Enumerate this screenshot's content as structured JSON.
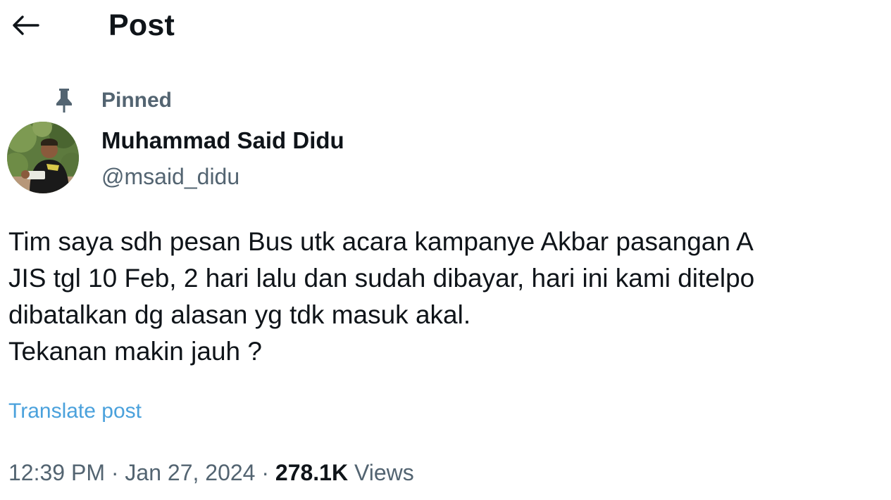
{
  "header": {
    "back_icon": "arrow-left-icon",
    "title": "Post"
  },
  "pinned": {
    "icon": "pin-icon",
    "label": "Pinned"
  },
  "author": {
    "name": "Muhammad Said Didu",
    "handle": "@msaid_didu"
  },
  "post": {
    "lines": [
      "Tim saya sdh pesan Bus utk acara kampanye Akbar pasangan A",
      "JIS tgl 10 Feb, 2 hari lalu dan sudah dibayar, hari ini kami ditelpo",
      "dibatalkan dg alasan yg tdk masuk akal.",
      "Tekanan makin jauh ?"
    ],
    "translate_label": "Translate post"
  },
  "meta": {
    "time": "12:39 PM",
    "sep1": " · ",
    "date": "Jan 27, 2024",
    "sep2": " · ",
    "views_count": "278.1K",
    "views_label": " Views"
  },
  "colors": {
    "text_primary": "#0f1419",
    "text_secondary": "#536471",
    "link": "#4aa1dc"
  }
}
